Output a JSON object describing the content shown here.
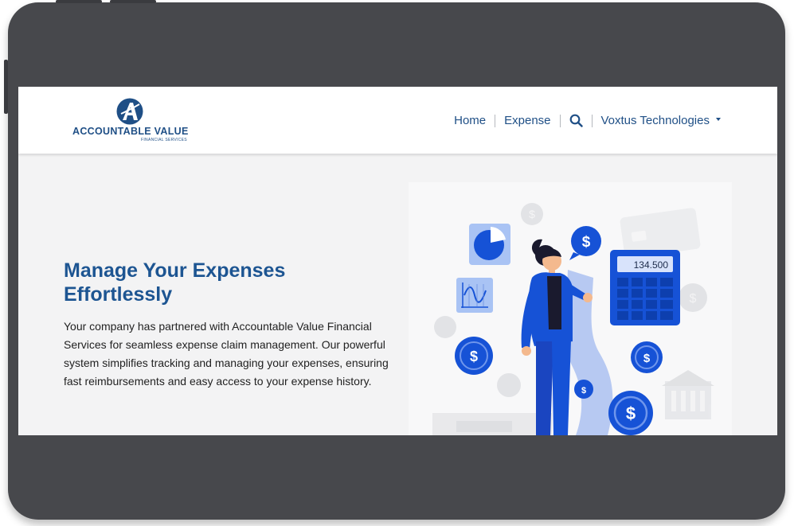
{
  "brand": {
    "name": "ACCOUNTABLE VALUE",
    "subtitle": "FINANCIAL SERVICES",
    "mark_letter": "A",
    "color": "#1f4f86"
  },
  "nav": {
    "home": "Home",
    "expense": "Expense",
    "search_icon": "search-icon",
    "company": "Voxtus Technologies"
  },
  "hero": {
    "title": "Manage Your Expenses Effortlessly",
    "body": "Your company has partnered with Accountable Value Financial Services for seamless expense claim management. Our powerful system simplifies tracking and managing your expenses, ensuring fast reimbursements and easy access to your expense history."
  },
  "illustration": {
    "calculator_display": "134.500",
    "dollar_symbol": "$"
  },
  "colors": {
    "accent": "#1d5592",
    "illustration_blue": "#1652d6",
    "device_frame": "#47484c"
  }
}
